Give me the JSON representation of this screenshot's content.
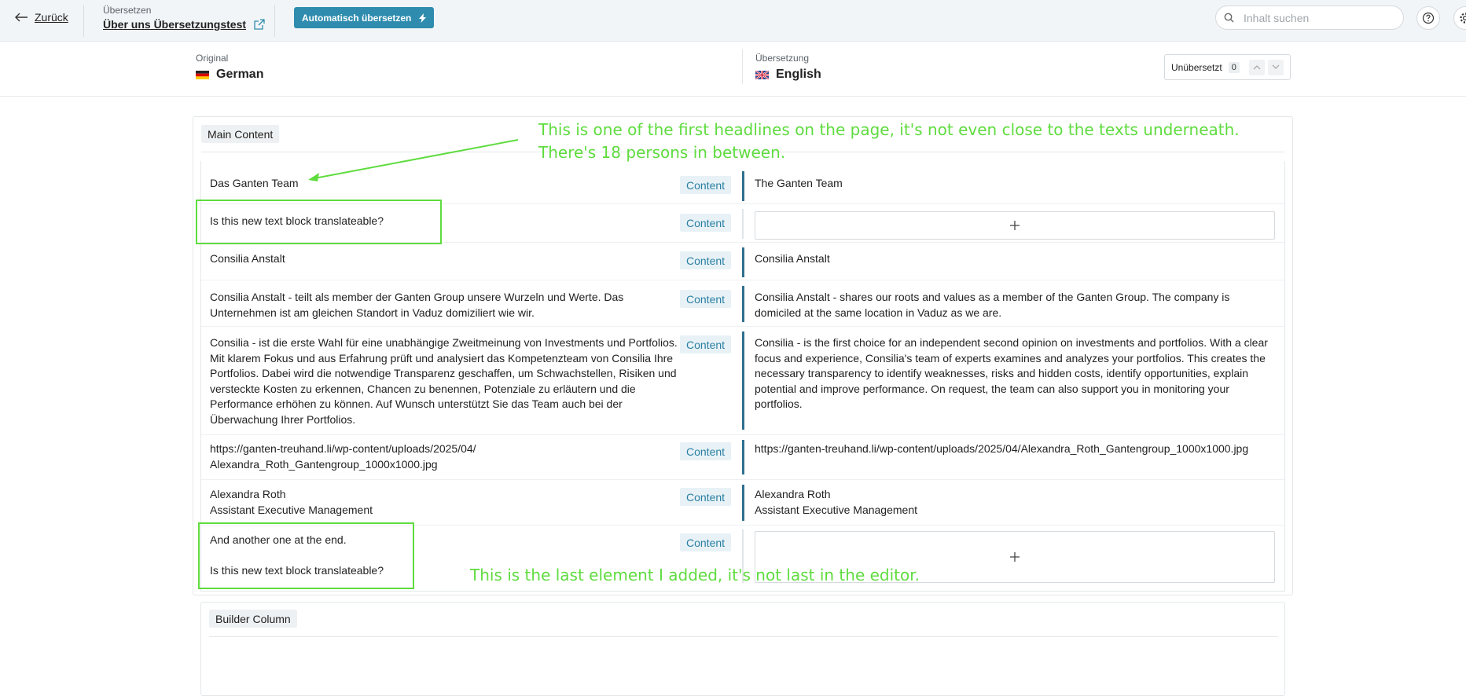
{
  "topbar": {
    "back_label": "Zurück",
    "doc_small": "Übersetzen",
    "doc_title": "Über uns Übersetzungstest",
    "auto_translate_label": "Automatisch übersetzen",
    "search_placeholder": "Inhalt suchen",
    "accent_color": "#2f8cae"
  },
  "languages": {
    "original_label": "Original",
    "original_name": "German",
    "translation_label": "Übersetzung",
    "translation_name": "English",
    "untranslated_label": "Unübersetzt",
    "untranslated_count": "0"
  },
  "groups": {
    "main": "Main Content",
    "builder": "Builder Column"
  },
  "rows": [
    {
      "source": "Das Ganten Team",
      "type": "Content",
      "target": "The Ganten Team"
    },
    {
      "source": "Is this new text block translateable?",
      "type": "Content",
      "target": ""
    },
    {
      "source": "Consilia Anstalt",
      "type": "Content",
      "target": "Consilia Anstalt"
    },
    {
      "source": "Consilia Anstalt - teilt als member der Ganten Group unsere Wurzeln und Werte. Das\nUnternehmen ist am gleichen Standort in Vaduz domiziliert wie wir.",
      "type": "Content",
      "target": "Consilia Anstalt - shares our roots and values as a member of the Ganten Group. The company is\ndomiciled at the same location in Vaduz as we are."
    },
    {
      "source": "Consilia - ist die erste Wahl für eine unabhängige Zweitmeinung von Investments und Portfolios.\nMit klarem Fokus und aus Erfahrung prüft und analysiert das Kompetenzteam von Consilia Ihre\nPortfolios. Dabei wird die notwendige Transparenz geschaffen, um Schwachstellen, Risiken und\nversteckte Kosten zu erkennen, Chancen zu benennen, Potenziale zu erläutern und die\nPerformance erhöhen zu können. Auf Wunsch unterstützt Sie das Team auch bei der\nÜberwachung Ihrer Portfolios.",
      "type": "Content",
      "target": "Consilia - is the first choice for an independent second opinion on investments and portfolios. With a clear\nfocus and experience, Consilia's team of experts examines and analyzes your portfolios. This creates the\nnecessary transparency to identify weaknesses, risks and hidden costs, identify opportunities, explain\npotential and improve performance. On request, the team can also support you in monitoring your\nportfolios."
    },
    {
      "source": "https://ganten-treuhand.li/wp-content/uploads/2025/04/\nAlexandra_Roth_Gantengroup_1000x1000.jpg",
      "type": "Content",
      "target": "https://ganten-treuhand.li/wp-content/uploads/2025/04/Alexandra_Roth_Gantengroup_1000x1000.jpg"
    },
    {
      "source": "Alexandra Roth\nAssistant Executive Management",
      "type": "Content",
      "target": "Alexandra Roth\nAssistant Executive Management"
    },
    {
      "source": "And another one at the end.\n\nIs this new text block translateable?",
      "type": "Content",
      "target": ""
    }
  ],
  "annotations": {
    "top_line1": "This is one of the first headlines on the page, it's not even close to the texts underneath.",
    "top_line2": "There's 18 persons in between.",
    "bottom": "This is the last element I added, it's not last in the editor.",
    "color": "#5fdc3f"
  },
  "icons": {
    "back": "arrow-left-icon",
    "external": "external-link-icon",
    "bolt": "bolt-icon",
    "search": "search-icon",
    "help": "help-icon",
    "settings": "gear-icon",
    "add": "plus-icon"
  }
}
